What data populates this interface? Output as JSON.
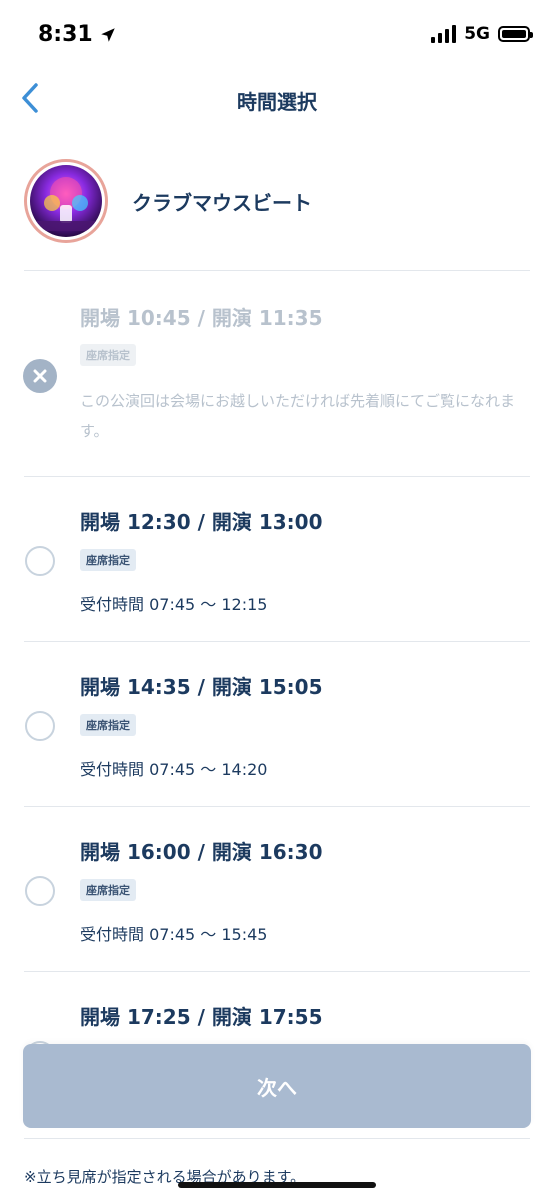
{
  "status_bar": {
    "time": "8:31",
    "network": "5G"
  },
  "header": {
    "title": "時間選択"
  },
  "show": {
    "title": "クラブマウスビート"
  },
  "slots": [
    {
      "title": "開場 10:45 / 開演 11:35",
      "badge": "座席指定",
      "note": "この公演回は会場にお越しいただければ先着順にてご覧になれます。",
      "disabled": true
    },
    {
      "title": "開場 12:30 / 開演 13:00",
      "badge": "座席指定",
      "reception": "受付時間 07:45 〜 12:15",
      "disabled": false
    },
    {
      "title": "開場 14:35 / 開演 15:05",
      "badge": "座席指定",
      "reception": "受付時間 07:45 〜 14:20",
      "disabled": false
    },
    {
      "title": "開場 16:00 / 開演 16:30",
      "badge": "座席指定",
      "reception": "受付時間 07:45 〜 15:45",
      "disabled": false
    },
    {
      "title": "開場 17:25 / 開演 17:55",
      "disabled": false
    }
  ],
  "next_button": {
    "label": "次へ"
  },
  "footnote": "※立ち見席が指定される場合があります。",
  "colors": {
    "primary_text": "#1c3a5f",
    "disabled_text": "#b8c2cd",
    "button_disabled": "#a9bad0",
    "back_arrow": "#3d8fd6"
  }
}
